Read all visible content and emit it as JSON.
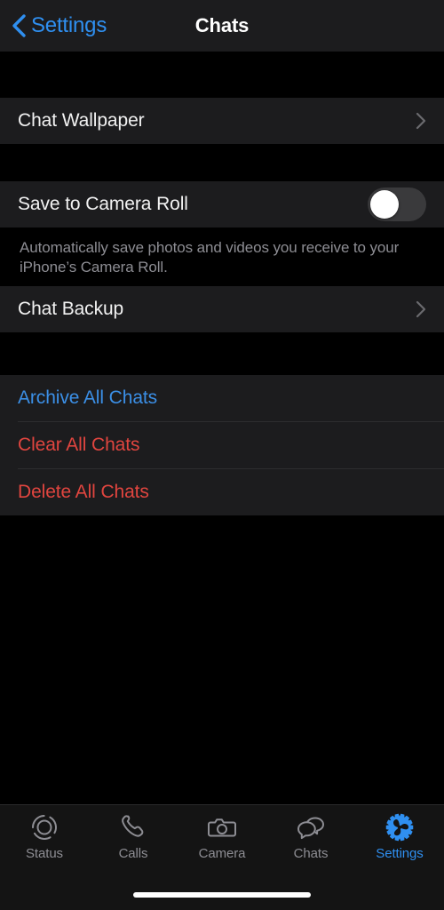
{
  "navbar": {
    "back_label": "Settings",
    "back_icon": "chevron-left-icon",
    "title": "Chats",
    "accent_color": "#2f8ff0"
  },
  "sections": [
    {
      "id": "wallpaper",
      "rows": [
        {
          "id": "chat-wallpaper",
          "label": "Chat Wallpaper",
          "type": "disclosure",
          "accessory": "chevron-right-icon",
          "style": "default"
        }
      ]
    },
    {
      "id": "media",
      "rows": [
        {
          "id": "save-to-camera-roll",
          "label": "Save to Camera Roll",
          "type": "toggle",
          "accessory": "toggle-switch",
          "value": "off",
          "style": "default"
        }
      ],
      "footer": "Automatically save photos and videos you receive to your iPhone’s Camera Roll."
    },
    {
      "id": "backup",
      "rows": [
        {
          "id": "chat-backup",
          "label": "Chat Backup",
          "type": "disclosure",
          "accessory": "chevron-right-icon",
          "style": "default"
        }
      ]
    },
    {
      "id": "actions",
      "rows": [
        {
          "id": "archive-all-chats",
          "label": "Archive All Chats",
          "type": "action",
          "accessory": "none",
          "style": "blue"
        },
        {
          "id": "clear-all-chats",
          "label": "Clear All Chats",
          "type": "action",
          "accessory": "none",
          "style": "red"
        },
        {
          "id": "delete-all-chats",
          "label": "Delete All Chats",
          "type": "action",
          "accessory": "none",
          "style": "red"
        }
      ]
    }
  ],
  "colors": {
    "page_background": "#000000",
    "cell_background": "#1c1c1e",
    "separator": "#2e2e30",
    "primary_text": "#f2f2f2",
    "secondary_text": "#8d8d93",
    "blue_action": "#3b8fe6",
    "red_action": "#e0453f",
    "toggle_track_off": "#3a3a3c",
    "toggle_knob": "#ffffff"
  },
  "tabbar": {
    "tabs": [
      {
        "id": "status",
        "label": "Status",
        "icon": "status-rings-icon",
        "active": false
      },
      {
        "id": "calls",
        "label": "Calls",
        "icon": "phone-icon",
        "active": false
      },
      {
        "id": "camera",
        "label": "Camera",
        "icon": "camera-icon",
        "active": false
      },
      {
        "id": "chats",
        "label": "Chats",
        "icon": "chat-bubbles-icon",
        "active": false
      },
      {
        "id": "settings",
        "label": "Settings",
        "icon": "gear-icon",
        "active": true
      }
    ],
    "active_color": "#2f8ff0",
    "inactive_color": "#8d8d93"
  }
}
